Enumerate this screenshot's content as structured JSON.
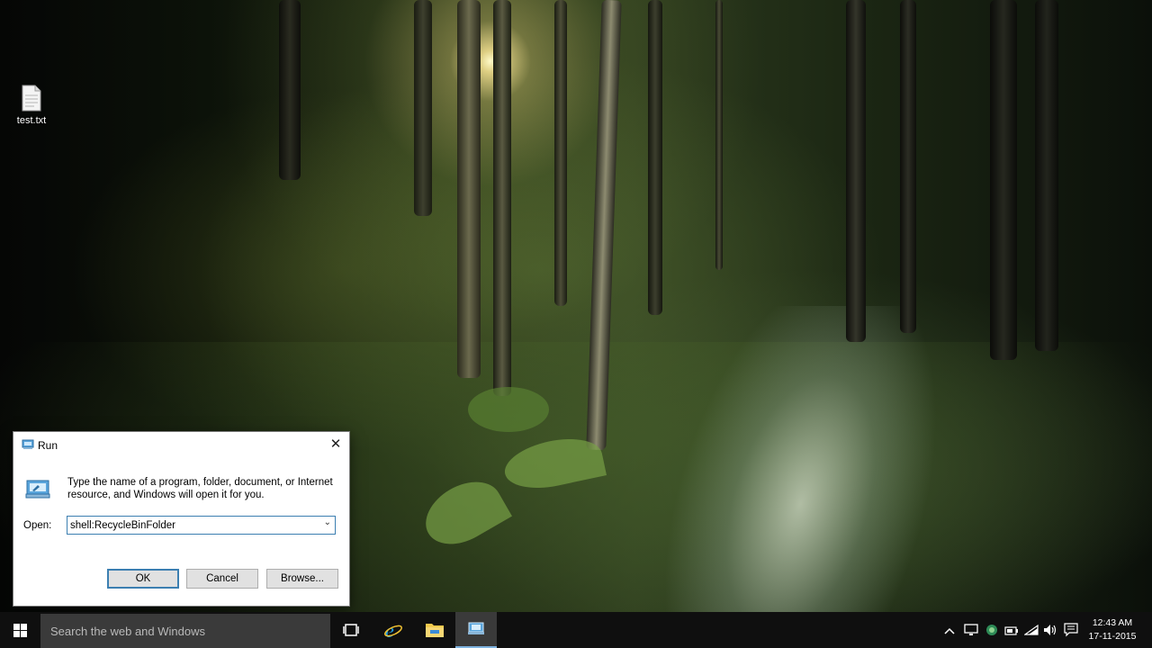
{
  "desktop": {
    "icons": [
      {
        "label": "test.txt",
        "icon": "text-file-icon"
      }
    ]
  },
  "run_dialog": {
    "title": "Run",
    "description": "Type the name of a program, folder, document, or Internet resource, and Windows will open it for you.",
    "open_label": "Open:",
    "input_value": "shell:RecycleBinFolder",
    "buttons": {
      "ok": "OK",
      "cancel": "Cancel",
      "browse": "Browse..."
    }
  },
  "taskbar": {
    "search_placeholder": "Search the web and Windows",
    "apps": [
      "task-view-icon",
      "internet-explorer-icon",
      "file-explorer-icon",
      "run-icon"
    ],
    "active_app": "run-icon",
    "tray_icons": [
      "chevron-up-icon",
      "display-icon",
      "network-shield-icon",
      "power-icon",
      "wifi-icon",
      "volume-icon",
      "notification-icon"
    ],
    "clock": {
      "time": "12:43 AM",
      "date": "17-11-2015"
    },
    "colors": {
      "taskbar": "#0f0f0f",
      "search": "#3a3a3a",
      "accent": "#7fb3e0"
    }
  }
}
